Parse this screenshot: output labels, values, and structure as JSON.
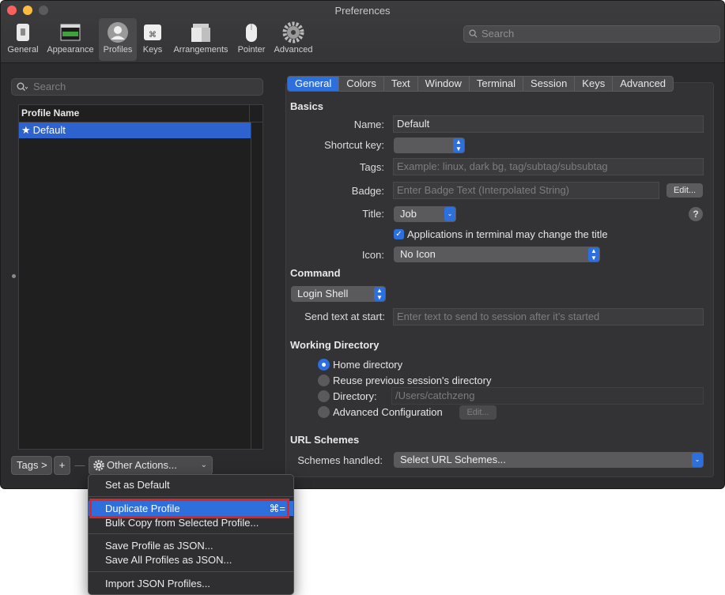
{
  "window": {
    "title": "Preferences"
  },
  "toolbar": {
    "items": [
      {
        "label": "General",
        "icon": "general-switch-icon"
      },
      {
        "label": "Appearance",
        "icon": "appearance-window-icon"
      },
      {
        "label": "Profiles",
        "icon": "profiles-person-icon"
      },
      {
        "label": "Keys",
        "icon": "keys-command-icon"
      },
      {
        "label": "Arrangements",
        "icon": "arrangements-windows-icon"
      },
      {
        "label": "Pointer",
        "icon": "pointer-mouse-icon"
      },
      {
        "label": "Advanced",
        "icon": "advanced-gear-icon"
      }
    ],
    "selected": "Profiles",
    "search_placeholder": "Search"
  },
  "left": {
    "search_placeholder": "Search",
    "table_header": "Profile Name",
    "profiles": [
      {
        "name": "Default",
        "is_default": true
      }
    ],
    "tags_button": "Tags >",
    "add_button": "+",
    "remove_button": "—",
    "other_actions_button": "Other Actions..."
  },
  "tabs": {
    "items": [
      "General",
      "Colors",
      "Text",
      "Window",
      "Terminal",
      "Session",
      "Keys",
      "Advanced"
    ],
    "active": "General"
  },
  "basics": {
    "heading": "Basics",
    "name_label": "Name:",
    "name_value": "Default",
    "shortcut_label": "Shortcut key:",
    "shortcut_value": "",
    "tags_label": "Tags:",
    "tags_placeholder": "Example: linux, dark bg, tag/subtag/subsubtag",
    "badge_label": "Badge:",
    "badge_placeholder": "Enter Badge Text (Interpolated String)",
    "badge_edit": "Edit...",
    "title_label": "Title:",
    "title_value": "Job",
    "help": "?",
    "allow_title_change": "Applications in terminal may change the title",
    "allow_title_change_checked": true,
    "icon_label": "Icon:",
    "icon_value": "No Icon"
  },
  "command": {
    "heading": "Command",
    "shell_value": "Login Shell",
    "send_text_label": "Send text at start:",
    "send_text_placeholder": "Enter text to send to session after it’s started"
  },
  "working_directory": {
    "heading": "Working Directory",
    "options": [
      "Home directory",
      "Reuse previous session's directory",
      "Directory:",
      "Advanced Configuration"
    ],
    "selected": "Home directory",
    "directory_placeholder": "/Users/catchzeng",
    "advanced_edit": "Edit..."
  },
  "url_schemes": {
    "heading": "URL Schemes",
    "label": "Schemes handled:",
    "value": "Select URL Schemes..."
  },
  "context_menu": {
    "items": [
      {
        "label": "Set as Default",
        "shortcut": ""
      },
      {
        "label": "Duplicate Profile",
        "shortcut": "⌘="
      },
      {
        "label": "Bulk Copy from Selected Profile...",
        "shortcut": ""
      },
      {
        "label": "Save Profile as JSON...",
        "shortcut": ""
      },
      {
        "label": "Save All Profiles as JSON...",
        "shortcut": ""
      },
      {
        "label": "Import JSON Profiles...",
        "shortcut": ""
      }
    ],
    "highlighted": "Duplicate Profile",
    "annotation_color": "#e8221a"
  },
  "colors": {
    "accent": "#2d6fdc",
    "selection": "#2c63cf",
    "window_bg": "#2b2b2d"
  }
}
